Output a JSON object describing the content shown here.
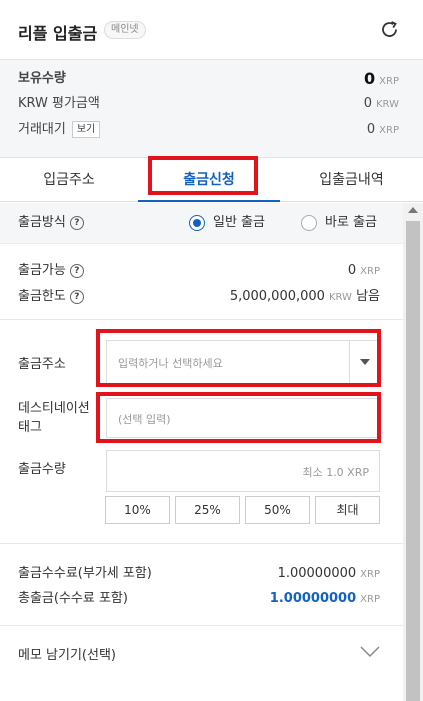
{
  "header": {
    "title": "리플 입출금",
    "network_badge": "메인넷"
  },
  "summary": {
    "holding_label": "보유수량",
    "holding_value": "0",
    "holding_unit": "XRP",
    "krw_label": "KRW 평가금액",
    "krw_value": "0",
    "krw_unit": "KRW",
    "pending_label": "거래대기",
    "view_button": "보기",
    "pending_value": "0",
    "pending_unit": "XRP"
  },
  "tabs": [
    {
      "label": "입금주소"
    },
    {
      "label": "출금신청"
    },
    {
      "label": "입출금내역"
    }
  ],
  "form": {
    "method_label": "출금방식",
    "help": "?",
    "method_options": [
      {
        "label": "일반 출금",
        "selected": true
      },
      {
        "label": "바로 출금",
        "selected": false
      }
    ],
    "available_label": "출금가능",
    "available_value": "0",
    "available_unit": "XRP",
    "limit_label": "출금한도",
    "limit_value": "5,000,000,000",
    "limit_unit": "KRW",
    "limit_suffix": "남음",
    "address_label": "출금주소",
    "address_placeholder": "입력하거나 선택하세요",
    "tag_label_line1": "데스티네이션",
    "tag_label_line2": "태그",
    "tag_placeholder": "(선택 입력)",
    "amount_label": "출금수량",
    "amount_placeholder": "최소 1.0 XRP",
    "pct_buttons": [
      "10%",
      "25%",
      "50%",
      "최대"
    ]
  },
  "fees": {
    "fee_label": "출금수수료(부가세 포함)",
    "fee_value": "1.00000000",
    "fee_unit": "XRP",
    "total_label": "총출금(수수료 포함)",
    "total_value": "1.00000000",
    "total_unit": "XRP"
  },
  "memo": {
    "label": "메모 남기기(선택)"
  },
  "colors": {
    "accent": "#1261c4",
    "highlight": "#e3131b",
    "summary_bg": "#f5f6f8"
  }
}
